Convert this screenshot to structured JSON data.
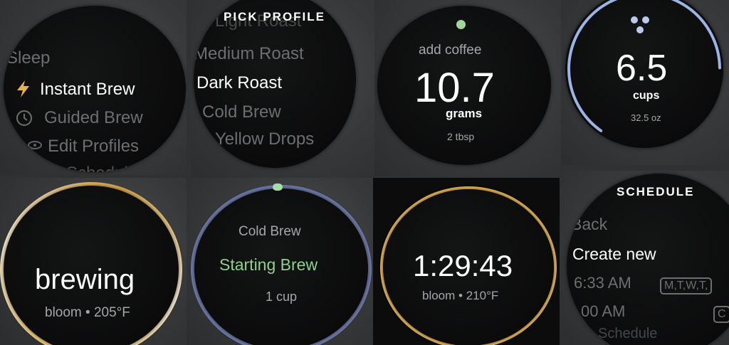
{
  "menu": {
    "items": [
      {
        "label": "Sleep"
      },
      {
        "label": "Instant Brew",
        "icon": "bolt-icon"
      },
      {
        "label": "Guided Brew",
        "icon": "clock-icon"
      },
      {
        "label": "Edit Profiles",
        "icon": "eye-icon"
      },
      {
        "label": "Schedule"
      }
    ]
  },
  "pick_profile": {
    "title": "PICK PROFILE",
    "items": [
      {
        "label": "Light Roast"
      },
      {
        "label": "Medium Roast"
      },
      {
        "label": "Dark Roast"
      },
      {
        "label": "Cold Brew"
      },
      {
        "label": "Yellow Drops"
      }
    ]
  },
  "add_coffee": {
    "caption": "add coffee",
    "value": "10.7",
    "unit": "grams",
    "alt": "2 tbsp",
    "dot_color": "#9fd6a0"
  },
  "cups": {
    "value": "6.5",
    "unit": "cups",
    "alt": "32.5 oz",
    "icon": "three-dots-icon",
    "arc_color": "#9bb4e6",
    "arc_fraction": 0.65
  },
  "brewing": {
    "status": "brewing",
    "detail": "bloom • 205°F",
    "ring_color": "#e0b25a"
  },
  "cold_brew": {
    "profile": "Cold Brew",
    "status": "Starting Brew",
    "amount": "1 cup",
    "status_color": "#8fcf8f",
    "ring_color": "#6e7aa8"
  },
  "timer": {
    "time": "1:29:43",
    "detail": "bloom • 210°F",
    "ring_color": "#e6b658"
  },
  "schedule": {
    "title": "SCHEDULE",
    "back": "Back",
    "create": "Create new",
    "entries": [
      {
        "time": "6:33 AM",
        "days": "M,T,W,T,"
      },
      {
        "time": "00 AM",
        "days": "C"
      }
    ],
    "extra": "Schedule"
  }
}
